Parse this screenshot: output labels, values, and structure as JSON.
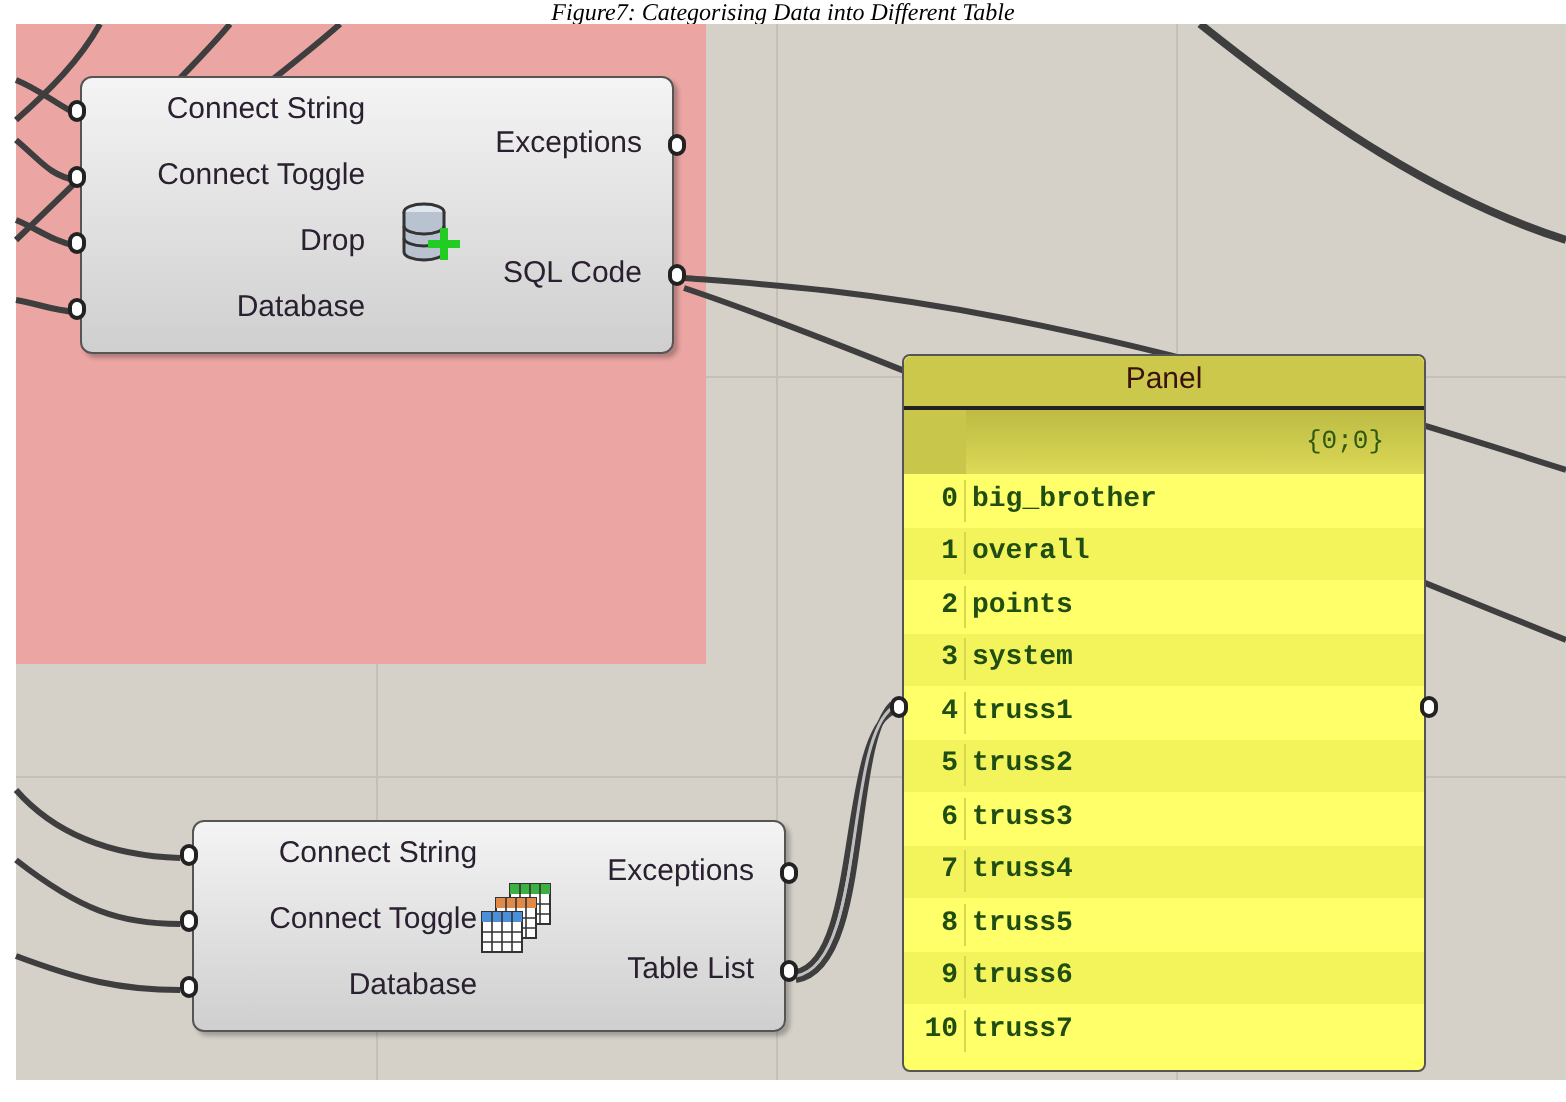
{
  "caption": "Figure7: Categorising Data into Different Table",
  "nodes": [
    {
      "kind": "database-add",
      "inputs": [
        "Connect String",
        "Connect Toggle",
        "Drop",
        "Database"
      ],
      "outputs": [
        "Exceptions",
        "SQL Code"
      ]
    },
    {
      "kind": "table-list",
      "inputs": [
        "Connect String",
        "Connect Toggle",
        "Database"
      ],
      "outputs": [
        "Exceptions",
        "Table List"
      ]
    }
  ],
  "panel": {
    "title": "Panel",
    "path": "{0;0}",
    "items": [
      {
        "index": "0",
        "value": "big_brother"
      },
      {
        "index": "1",
        "value": "overall"
      },
      {
        "index": "2",
        "value": "points"
      },
      {
        "index": "3",
        "value": "system"
      },
      {
        "index": "4",
        "value": "truss1"
      },
      {
        "index": "5",
        "value": "truss2"
      },
      {
        "index": "6",
        "value": "truss3"
      },
      {
        "index": "7",
        "value": "truss4"
      },
      {
        "index": "8",
        "value": "truss5"
      },
      {
        "index": "9",
        "value": "truss6"
      },
      {
        "index": "10",
        "value": "truss7"
      }
    ]
  }
}
